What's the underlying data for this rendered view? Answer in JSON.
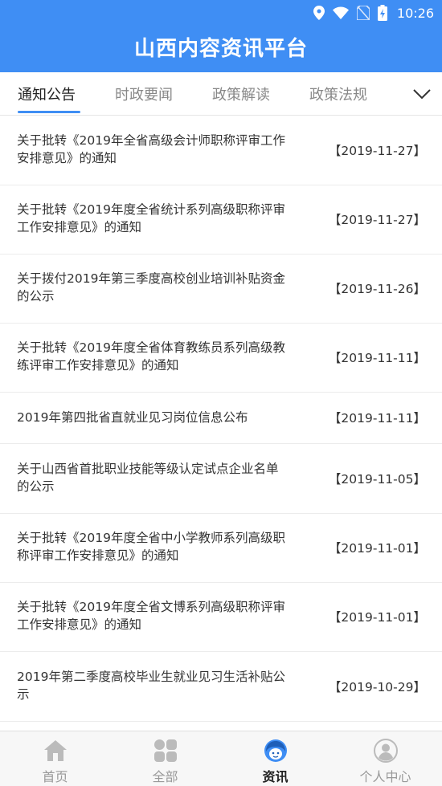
{
  "status_bar": {
    "time": "10:26"
  },
  "header": {
    "title": "山西内容资讯平台"
  },
  "tabs": [
    {
      "label": "通知公告",
      "active": true
    },
    {
      "label": "时政要闻",
      "active": false
    },
    {
      "label": "政策解读",
      "active": false
    },
    {
      "label": "政策法规",
      "active": false
    }
  ],
  "news": [
    {
      "title": "关于批转《2019年全省高级会计师职称评审工作安排意见》的通知",
      "date": "【2019-11-27】"
    },
    {
      "title": "关于批转《2019年度全省统计系列高级职称评审工作安排意见》的通知",
      "date": "【2019-11-27】"
    },
    {
      "title": "关于拨付2019年第三季度高校创业培训补贴资金的公示",
      "date": "【2019-11-26】"
    },
    {
      "title": "关于批转《2019年度全省体育教练员系列高级教练评审工作安排意见》的通知",
      "date": "【2019-11-11】"
    },
    {
      "title": "2019年第四批省直就业见习岗位信息公布",
      "date": "【2019-11-11】"
    },
    {
      "title": "关于山西省首批职业技能等级认定试点企业名单的公示",
      "date": "【2019-11-05】"
    },
    {
      "title": "关于批转《2019年度全省中小学教师系列高级职称评审工作安排意见》的通知",
      "date": "【2019-11-01】"
    },
    {
      "title": "关于批转《2019年度全省文博系列高级职称评审工作安排意见》的通知",
      "date": "【2019-11-01】"
    },
    {
      "title": "2019年第二季度高校毕业生就业见习生活补贴公示",
      "date": "【2019-10-29】"
    }
  ],
  "tabbar": [
    {
      "label": "首页",
      "icon": "home-icon",
      "active": false
    },
    {
      "label": "全部",
      "icon": "grid-icon",
      "active": false
    },
    {
      "label": "资讯",
      "icon": "news-avatar-icon",
      "active": true
    },
    {
      "label": "个人中心",
      "icon": "user-icon",
      "active": false
    }
  ],
  "colors": {
    "primary": "#3f8ef4",
    "inactive": "#bbbbbb"
  }
}
